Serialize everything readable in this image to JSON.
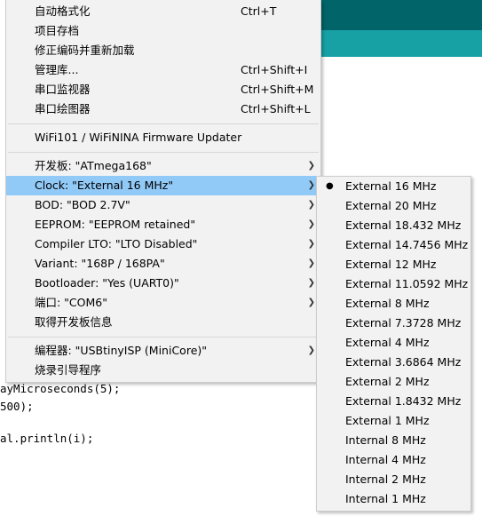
{
  "main_menu": {
    "items": [
      {
        "label": "自动格式化",
        "accel": "Ctrl+T"
      },
      {
        "label": "项目存档",
        "accel": ""
      },
      {
        "label": "修正编码并重新加载",
        "accel": ""
      },
      {
        "label": "管理库...",
        "accel": "Ctrl+Shift+I"
      },
      {
        "label": "串口监视器",
        "accel": "Ctrl+Shift+M"
      },
      {
        "label": "串口绘图器",
        "accel": "Ctrl+Shift+L"
      },
      {
        "label": "WiFi101 / WiFiNINA Firmware Updater",
        "accel": ""
      },
      {
        "label": "开发板: \"ATmega168\"",
        "accel": ""
      },
      {
        "label": "Clock: \"External 16 MHz\"",
        "accel": ""
      },
      {
        "label": "BOD: \"BOD 2.7V\"",
        "accel": ""
      },
      {
        "label": "EEPROM: \"EEPROM retained\"",
        "accel": ""
      },
      {
        "label": "Compiler LTO: \"LTO Disabled\"",
        "accel": ""
      },
      {
        "label": "Variant: \"168P / 168PA\"",
        "accel": ""
      },
      {
        "label": "Bootloader: \"Yes (UART0)\"",
        "accel": ""
      },
      {
        "label": "端口: \"COM6\"",
        "accel": ""
      },
      {
        "label": "取得开发板信息",
        "accel": ""
      },
      {
        "label": "编程器: \"USBtinyISP (MiniCore)\"",
        "accel": ""
      },
      {
        "label": "烧录引导程序",
        "accel": ""
      }
    ]
  },
  "clock_submenu": {
    "selected_index": 0,
    "items": [
      "External 16 MHz",
      "External 20 MHz",
      "External 18.432 MHz",
      "External 14.7456 MHz",
      "External 12 MHz",
      "External 11.0592 MHz",
      "External 8 MHz",
      "External 7.3728 MHz",
      "External 4 MHz",
      "External 3.6864 MHz",
      "External 2 MHz",
      "External 1.8432 MHz",
      "External 1 MHz",
      "Internal 8 MHz",
      "Internal 4 MHz",
      "Internal 2 MHz",
      "Internal 1 MHz"
    ]
  },
  "editor": {
    "lines": [
      "ayMicroseconds(5);",
      "500);",
      "al.println(i);"
    ]
  },
  "icons": {
    "submenu_arrow": "chevron-right-icon",
    "selected_bullet": "radio-bullet-icon"
  },
  "colors": {
    "highlight": "#91c9f7",
    "menu_bg": "#f2f2f2",
    "teal_dark": "#006468",
    "teal_light": "#17a1a5"
  }
}
